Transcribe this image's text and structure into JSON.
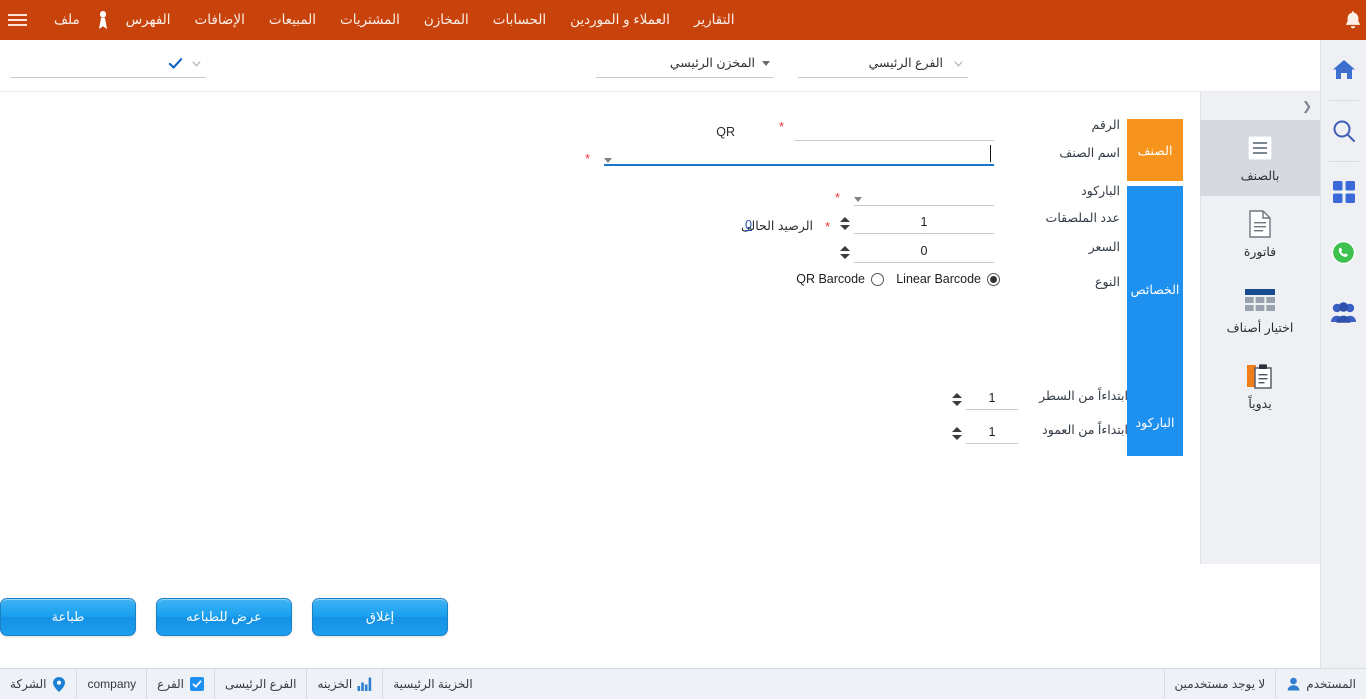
{
  "app": {
    "accent_orange": "#c8430c",
    "accent_blue": "#1e90f0",
    "accent_amber": "#f7941d"
  },
  "topnav": {
    "bell_icon": "bell-icon",
    "hamburger_icon": "hamburger-icon",
    "user_icon": "user-ribbon-icon",
    "items": [
      {
        "label": "ملف",
        "name": "nav-file"
      },
      {
        "label": "الفهرس",
        "name": "nav-index"
      },
      {
        "label": "الإضافات",
        "name": "nav-addons"
      },
      {
        "label": "المبيعات",
        "name": "nav-sales"
      },
      {
        "label": "المشتريات",
        "name": "nav-purchases"
      },
      {
        "label": "المخازن",
        "name": "nav-stores"
      },
      {
        "label": "الحسابات",
        "name": "nav-accounts"
      },
      {
        "label": "العملاء و الموردين",
        "name": "nav-customers-suppliers"
      },
      {
        "label": "التقارير",
        "name": "nav-reports"
      }
    ]
  },
  "filterbar": {
    "branch": {
      "value": "الفرع الرئيسي",
      "name": "branch-select"
    },
    "store": {
      "value": "المخزن الرئيسي",
      "name": "store-select"
    },
    "third": {
      "value": "",
      "name": "extra-select"
    }
  },
  "tabs": {
    "item": "الصنف",
    "properties": "الخصائص",
    "barcode": "الباركود"
  },
  "form": {
    "number": {
      "label": "الرقم",
      "value": "",
      "required": true,
      "qr_label": "QR"
    },
    "item_name": {
      "label": "اسم الصنف",
      "value": "",
      "required": true,
      "focused": true
    },
    "barcode": {
      "label": "الباركود",
      "value": "",
      "required": true
    },
    "labels_count": {
      "label": "عدد الملصقات",
      "value": "1",
      "required": true
    },
    "current_balance": {
      "label": "الرصيد الحالى",
      "value": "0"
    },
    "price": {
      "label": "السعر",
      "value": "0"
    },
    "type": {
      "label": "النوع",
      "options": [
        {
          "label": "Linear Barcode",
          "selected": true,
          "name": "radio-linear-barcode"
        },
        {
          "label": "QR Barcode",
          "selected": false,
          "name": "radio-qr-barcode"
        }
      ]
    },
    "start_row": {
      "label": "ابتداءاً من السطر",
      "value": "1"
    },
    "start_col": {
      "label": "ابتداءاً من العمود",
      "value": "1"
    }
  },
  "sidepanel": {
    "collapse_icon": "chevron-right-icon",
    "modes": [
      {
        "label": "بالصنف",
        "icon": "list-lines-icon",
        "active": true,
        "name": "mode-by-item"
      },
      {
        "label": "فاتورة",
        "icon": "document-icon",
        "active": false,
        "name": "mode-invoice"
      },
      {
        "label": "اختيار أصناف",
        "icon": "grid-table-icon",
        "active": false,
        "name": "mode-select-items"
      },
      {
        "label": "يدوياً",
        "icon": "clipboard-icon",
        "active": false,
        "name": "mode-manual"
      }
    ]
  },
  "rail": {
    "items": [
      {
        "icon": "home-icon",
        "name": "rail-home"
      },
      {
        "icon": "search-icon",
        "name": "rail-search"
      },
      {
        "icon": "apps-grid-icon",
        "name": "rail-apps"
      },
      {
        "icon": "whatsapp-icon",
        "name": "rail-whatsapp"
      },
      {
        "icon": "users-icon",
        "name": "rail-users"
      }
    ]
  },
  "buttons": {
    "print": "طباعة",
    "preview": "عرض للطباعه",
    "close": "إغلاق"
  },
  "statusbar": {
    "company_label": "الشركة",
    "company_value": "company",
    "branch_label": "الفرع",
    "branch_value": "الفرع الرئيسى",
    "treasury_label": "الخزينه",
    "treasury_value": "الخزينة الرئيسية",
    "user_label": "المستخدم",
    "user_value": "لا يوجد مستخدمين",
    "company_icon": "location-pin-icon",
    "branch_icon": "check-box-icon",
    "treasury_icon": "bar-chart-icon",
    "user_icon": "user-icon"
  }
}
